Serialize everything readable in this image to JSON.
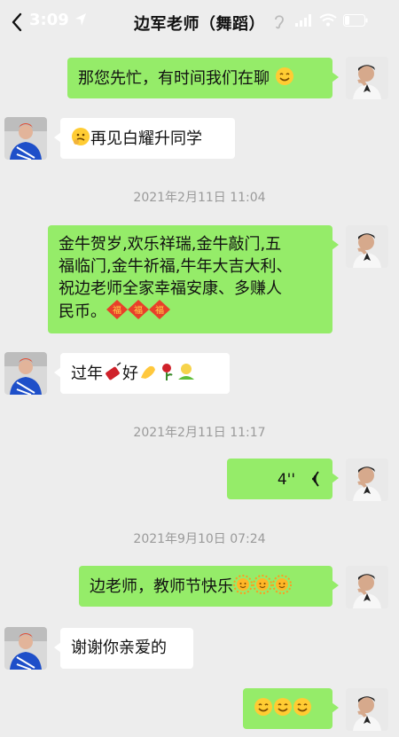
{
  "status_bar": {
    "time": "3:09"
  },
  "header": {
    "title": "边军老师（舞蹈）"
  },
  "messages": {
    "m1": {
      "text": "那您先忙，有时间我们在聊"
    },
    "m2": {
      "text": "再见白耀升同学"
    },
    "t1": {
      "text": "2021年2月11日 11:04"
    },
    "m3": {
      "line1": "金牛贺岁,欢乐祥瑞,金牛敲门,五",
      "line2": "福临门,金牛祈福,牛年大吉大利、",
      "line3": "祝边老师全家幸福安康、多赚人",
      "line4": "民币。"
    },
    "m4": {
      "pre": "过年",
      "post": "好"
    },
    "t2": {
      "text": "2021年2月11日 11:17"
    },
    "m5": {
      "duration": "4''"
    },
    "t3": {
      "text": "2021年9月10日 07:24"
    },
    "m6": {
      "text": "边老师，教师节快乐"
    },
    "m7": {
      "text": "谢谢你亲爱的"
    }
  },
  "icons": {
    "back": "chevron-left-icon",
    "location": "location-arrow-icon",
    "hearing": "ear-icon",
    "signal": "signal-icon",
    "wifi": "wifi-icon",
    "battery": "battery-icon",
    "voice": "voice-wave-icon"
  },
  "colors": {
    "bg": "#ededed",
    "me_bubble": "#95ec69",
    "them_bubble": "#ffffff",
    "timestamp": "#9a9a9a"
  }
}
